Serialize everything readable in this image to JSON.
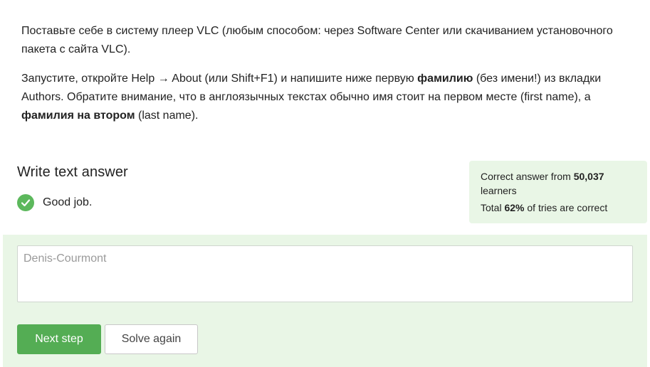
{
  "step": {
    "p1": "Поставьте себе в систему плеер VLC (любым способом: через Software Center или скачиванием установочного пакета с сайта VLC).",
    "p2_a": "Запустите, откройте Help → About (или Shift+F1) и напишите ниже первую ",
    "p2_b": "фамилию",
    "p2_c": " (без имени!) из вкладки Authors. Обратите внимание, что в англоязычных текстах обычно имя стоит на первом месте (first name), а ",
    "p2_d": "фамилия на втором",
    "p2_e": " (last name)."
  },
  "answer": {
    "title": "Write text answer",
    "feedback": "Good job.",
    "placeholder": "Denis-Courmont",
    "value": ""
  },
  "stats": {
    "line1_prefix": "Correct answer from ",
    "learners_count": "50,037",
    "line1_suffix": " learners",
    "line2_prefix": "Total ",
    "percent": "62%",
    "line2_suffix": " of tries are correct"
  },
  "buttons": {
    "next": "Next step",
    "solve_again": "Solve again"
  },
  "colors": {
    "accent": "#54ad54",
    "panel_bg": "#e9f6e6"
  },
  "icons": {
    "feedback": "check-circle-icon"
  }
}
